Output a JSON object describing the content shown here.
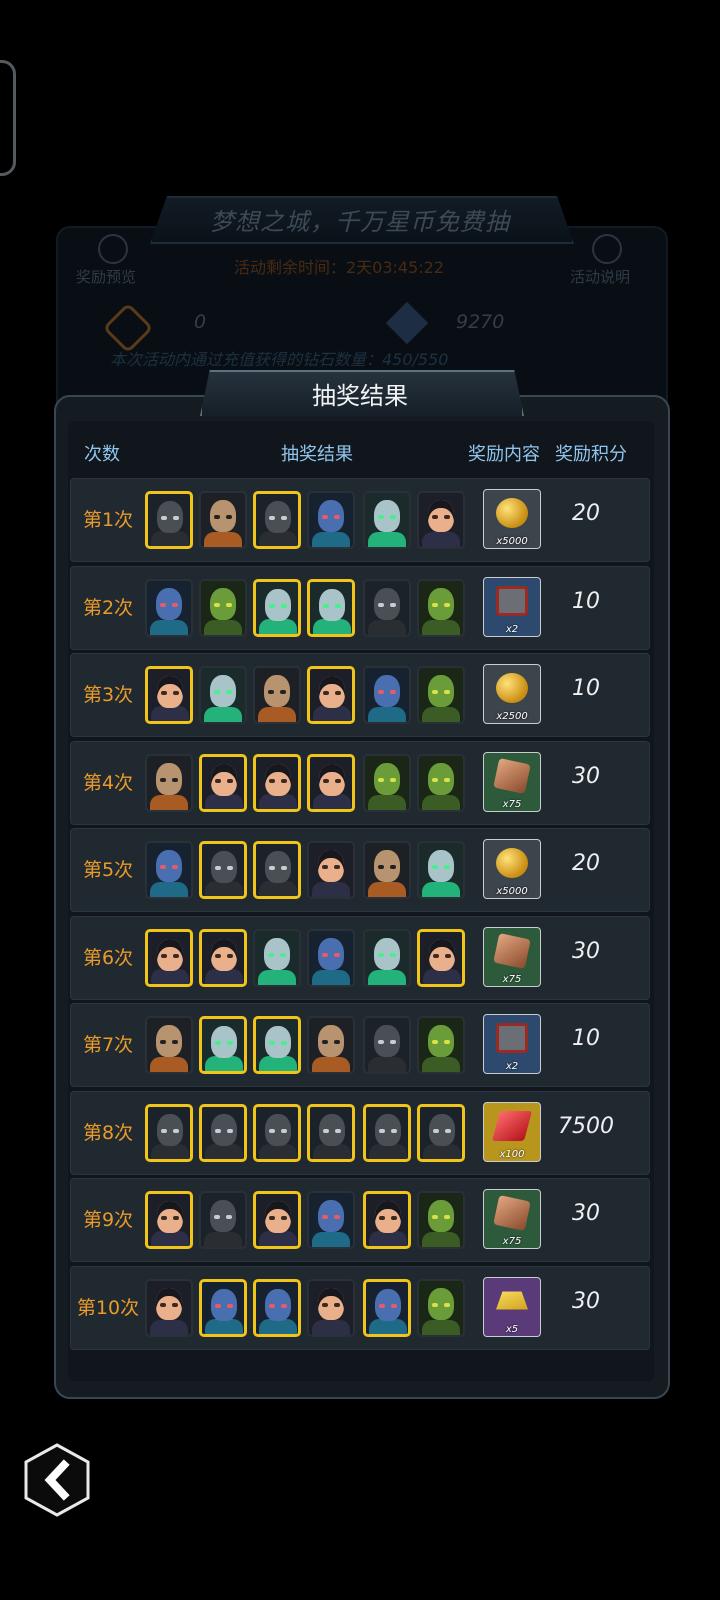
{
  "background": {
    "title": "梦想之城，千万星币免费抽",
    "reward_preview": "奖励预览",
    "activity_info": "活动说明",
    "timer": "活动剩余时间：2天03:45:22",
    "coins": "0",
    "diamonds": "9270",
    "recharge_desc": "本次活动内通过充值获得的钻石数量：450/550"
  },
  "panel": {
    "title": "抽奖结果",
    "headers": {
      "count": "次数",
      "results": "抽奖结果",
      "reward": "奖励内容",
      "points": "奖励积分"
    }
  },
  "rows": [
    {
      "label": "第1次",
      "heroes": [
        "ninja",
        "pug",
        "ninja",
        "helmet",
        "mask",
        "girl"
      ],
      "highlight": [
        1,
        0,
        1,
        0,
        0,
        0
      ],
      "reward": {
        "icon": "gold-coins-icon",
        "qty": "x5000",
        "bg": "#3c444c"
      },
      "points": "20"
    },
    {
      "label": "第2次",
      "heroes": [
        "helmet",
        "lizard",
        "mask",
        "mask",
        "ninja",
        "lizard"
      ],
      "highlight": [
        0,
        0,
        1,
        1,
        0,
        0
      ],
      "reward": {
        "icon": "armor-box-icon",
        "qty": "x2",
        "bg": "#2d4a6e"
      },
      "points": "10"
    },
    {
      "label": "第3次",
      "heroes": [
        "girl",
        "mask",
        "pug",
        "girl",
        "helmet",
        "lizard"
      ],
      "highlight": [
        1,
        0,
        0,
        1,
        0,
        0
      ],
      "reward": {
        "icon": "gold-coins-icon",
        "qty": "x2500",
        "bg": "#3c444c"
      },
      "points": "10"
    },
    {
      "label": "第4次",
      "heroes": [
        "pug",
        "girl",
        "girl",
        "girl",
        "lizard",
        "lizard"
      ],
      "highlight": [
        0,
        1,
        1,
        1,
        0,
        0
      ],
      "reward": {
        "icon": "copper-ore-icon",
        "qty": "x75",
        "bg": "#2e5a3c"
      },
      "points": "30"
    },
    {
      "label": "第5次",
      "heroes": [
        "helmet",
        "ninja",
        "ninja",
        "girl",
        "pug",
        "mask"
      ],
      "highlight": [
        0,
        1,
        1,
        0,
        0,
        0
      ],
      "reward": {
        "icon": "gold-coins-icon",
        "qty": "x5000",
        "bg": "#3c444c"
      },
      "points": "20"
    },
    {
      "label": "第6次",
      "heroes": [
        "girl",
        "girl",
        "mask",
        "helmet",
        "mask",
        "girl"
      ],
      "highlight": [
        1,
        1,
        0,
        0,
        0,
        1
      ],
      "reward": {
        "icon": "copper-ore-icon",
        "qty": "x75",
        "bg": "#2e5a3c"
      },
      "points": "30"
    },
    {
      "label": "第7次",
      "heroes": [
        "pug",
        "mask",
        "mask",
        "pug",
        "ninja",
        "lizard"
      ],
      "highlight": [
        0,
        1,
        1,
        0,
        0,
        0
      ],
      "reward": {
        "icon": "armor-box-icon",
        "qty": "x2",
        "bg": "#2d4a6e"
      },
      "points": "10"
    },
    {
      "label": "第8次",
      "heroes": [
        "ninja",
        "ninja",
        "ninja",
        "ninja",
        "ninja",
        "ninja"
      ],
      "highlight": [
        1,
        1,
        1,
        1,
        1,
        1
      ],
      "reward": {
        "icon": "red-gem-icon",
        "qty": "x100",
        "bg": "#b8961e"
      },
      "points": "7500"
    },
    {
      "label": "第9次",
      "heroes": [
        "girl",
        "ninja",
        "girl",
        "helmet",
        "girl",
        "lizard"
      ],
      "highlight": [
        1,
        0,
        1,
        0,
        1,
        0
      ],
      "reward": {
        "icon": "copper-ore-icon",
        "qty": "x75",
        "bg": "#2e5a3c"
      },
      "points": "30"
    },
    {
      "label": "第10次",
      "heroes": [
        "girl",
        "helmet",
        "helmet",
        "girl",
        "helmet",
        "lizard"
      ],
      "highlight": [
        0,
        1,
        1,
        0,
        1,
        0
      ],
      "reward": {
        "icon": "gold-bar-icon",
        "qty": "x5",
        "bg": "#5a3a78"
      },
      "points": "30"
    }
  ]
}
